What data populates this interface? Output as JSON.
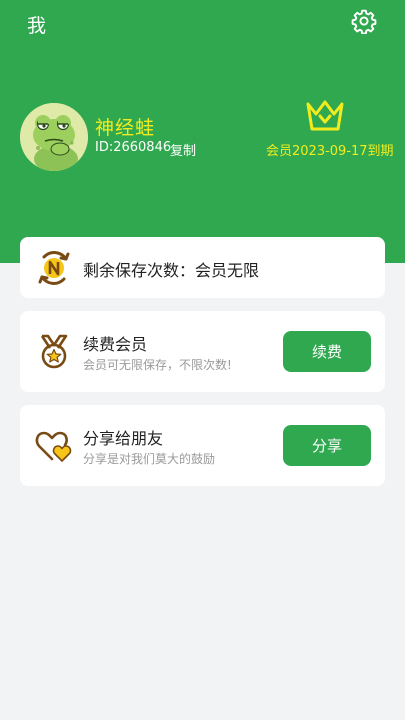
{
  "header": {
    "title": "我",
    "settings_icon": "gear-icon"
  },
  "profile": {
    "avatar_icon": "frog-avatar",
    "username": "神经蛙",
    "id_text": "ID:2660846",
    "copy_label": "复制",
    "vip_icon": "crown-icon",
    "vip_expiry": "会员2023-09-17到期"
  },
  "remaining": {
    "icon": "n-coin-icon",
    "text": "剩余保存次数：会员无限"
  },
  "renew": {
    "icon": "medal-icon",
    "title": "续费会员",
    "subtitle": "会员可无限保存，不限次数!",
    "button_label": "续费"
  },
  "share": {
    "icon": "hearts-icon",
    "title": "分享给朋友",
    "subtitle": "分享是对我们莫大的鼓励",
    "button_label": "分享"
  },
  "colors": {
    "brand_green": "#2fa84f",
    "highlight_yellow": "#f2ec1f",
    "icon_brown": "#7a4a14",
    "icon_gold": "#f5c518"
  }
}
